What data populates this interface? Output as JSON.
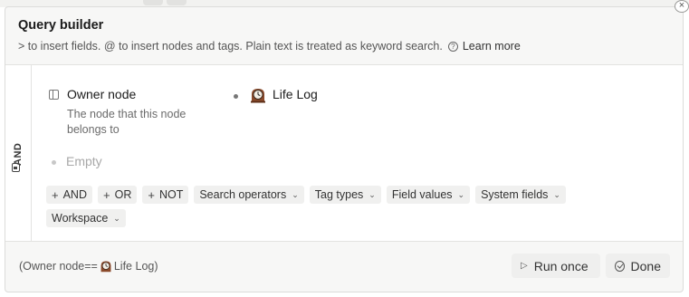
{
  "dialog": {
    "title": "Query builder",
    "hint": "> to insert fields. @ to insert nodes and tags. Plain text is treated as keyword search.",
    "learn_more": "Learn more",
    "close_icon": "close-icon"
  },
  "group": {
    "operator": "AND"
  },
  "condition": {
    "field_name": "Owner node",
    "field_description": "The node that this node belongs to",
    "value_label": "Life Log",
    "value_icon": "clock-icon"
  },
  "empty_row": {
    "label": "Empty"
  },
  "chips": [
    {
      "label": "AND",
      "kind": "plus"
    },
    {
      "label": "OR",
      "kind": "plus"
    },
    {
      "label": "NOT",
      "kind": "plus"
    },
    {
      "label": "Search operators",
      "kind": "dropdown"
    },
    {
      "label": "Tag types",
      "kind": "dropdown"
    },
    {
      "label": "Field values",
      "kind": "dropdown"
    },
    {
      "label": "System fields",
      "kind": "dropdown"
    },
    {
      "label": "Workspace",
      "kind": "dropdown"
    }
  ],
  "footer": {
    "expression_prefix": "(Owner node==",
    "expression_value": "Life Log)",
    "run_once": "Run once",
    "done": "Done"
  }
}
